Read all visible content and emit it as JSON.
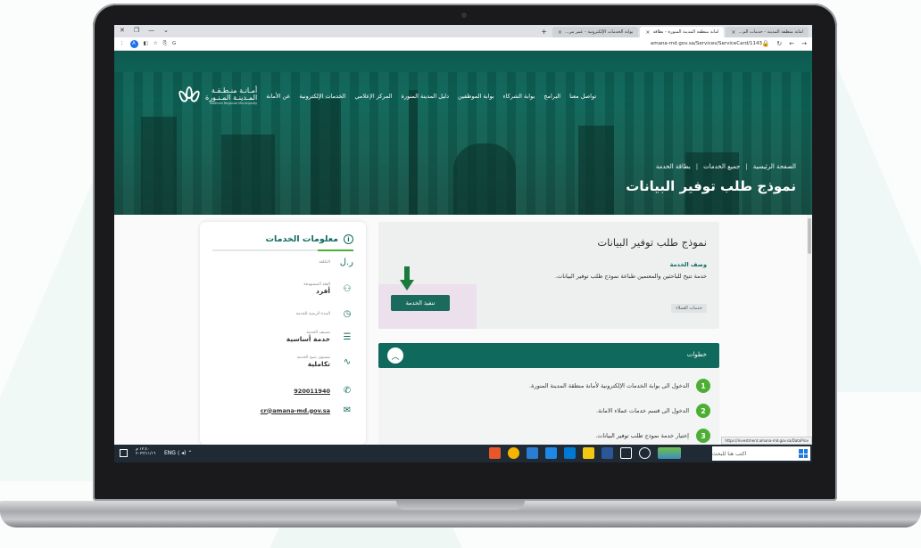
{
  "browser": {
    "tabs": [
      {
        "label": "امانة منطقة المدينة - خدمات الم...",
        "active": false
      },
      {
        "label": "امانة منطقة المدينة المنورة - بطاقة",
        "active": true
      },
      {
        "label": "بوابة الخدمات الإلكترونية - عمر مر...",
        "active": false
      }
    ],
    "url": "amana-md.gov.sa/Services/ServiceCard/1143"
  },
  "site": {
    "logo_line1": "أمـانـة منـطـقـة",
    "logo_line2": "المـدينـة المـنـورة",
    "logo_line3": "Madinah Regional Municipality",
    "nav": [
      "عن الأمانة",
      "الخدمات الإلكترونية",
      "المركز الإعلامي",
      "دليل المدينة المنورة",
      "بوابة الموظفين",
      "بوابة الشركاء",
      "البرامج",
      "تواصل معنا"
    ],
    "breadcrumbs": [
      "الصفحة الرئيسية",
      "جميع الخدمات",
      "بطاقة الخدمة"
    ],
    "hero_title": "نموذج طلب توفير البيانات"
  },
  "service": {
    "title": "نموذج طلب توفير البيانات",
    "description_label": "وصف الخدمة",
    "description": "خدمة تتيح للباحثين والمعتمين طباعة نموذج طلب توفير البيانات.",
    "tag": "خدمات العملاء",
    "execute_label": "تنفيذ الخدمة"
  },
  "steps": {
    "header": "خطوات",
    "items": [
      {
        "num": "1",
        "text": "الدخول الى بوابة الخدمات الإلكترونية لأمانة منطقة المدينة المنورة."
      },
      {
        "num": "2",
        "text": "الدخول الى قسم خدمات عملاء الامانة."
      },
      {
        "num": "3",
        "text": "إختيار خدمة نموذج طلب توفير البيانات."
      }
    ]
  },
  "sidebar": {
    "title": "معلومات الخدمات",
    "cost_label": "التكلفة",
    "audience_label": "الفئة المستهدفة",
    "audience_value": "أفرد",
    "duration_label": "المدة الزمنية للخدمة",
    "category_label": "تصنيف الخدمة",
    "category_value": "خدمة أساسية",
    "maturity_label": "مستوى نضج الخدمة",
    "maturity_value": "تكاملية",
    "phone": "920011940",
    "email": "cr@amana-md.gov.sa"
  },
  "taskbar": {
    "search_placeholder": "اكتب هنا للبحث",
    "clock_time": "١٢:٤٠ م",
    "clock_date": "٢٠٢٣/١١/١٦",
    "status_url": "https://investment.amana-md.gov.sa/DataProv"
  },
  "colors": {
    "brand": "#0f6a5d",
    "step": "#4caf34",
    "arrow": "#1a7a3c"
  }
}
